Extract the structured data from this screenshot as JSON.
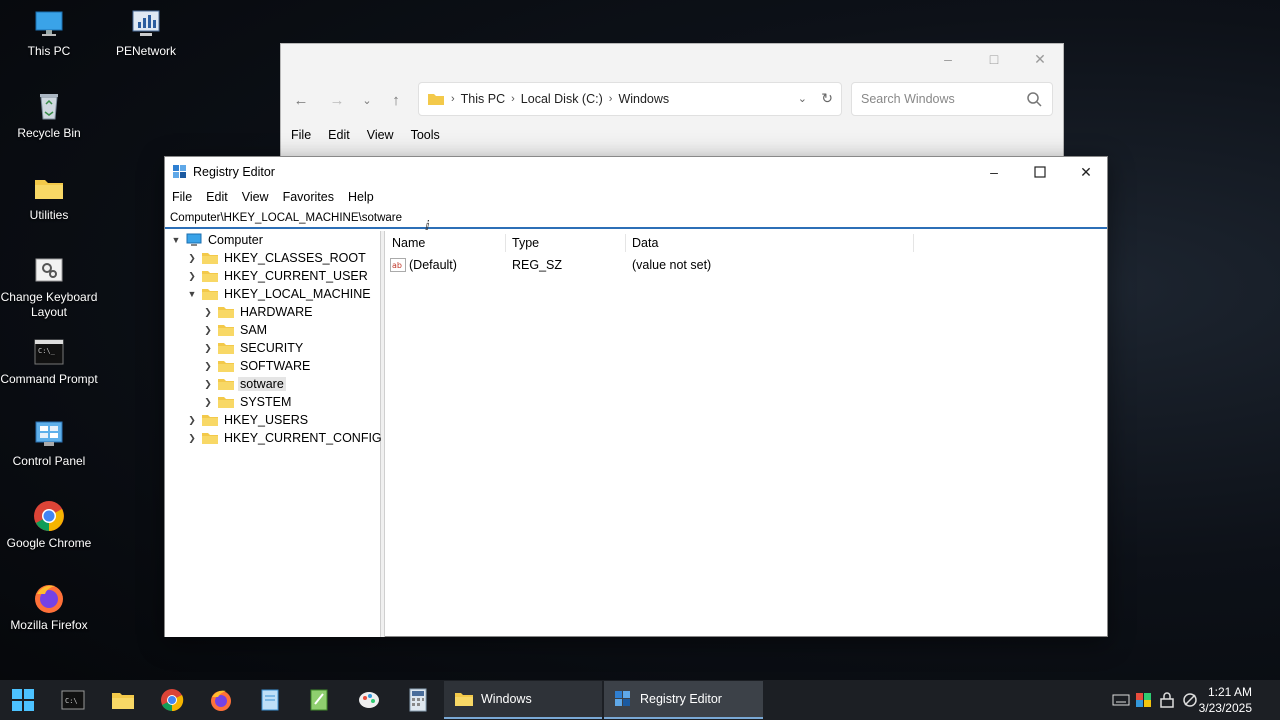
{
  "desktop": {
    "icons": [
      {
        "label": "This PC",
        "icon": "monitor-icon"
      },
      {
        "label": "PENetwork",
        "icon": "network-icon"
      },
      {
        "label": "Recycle Bin",
        "icon": "recycle-bin-icon"
      },
      {
        "label": "Utilities",
        "icon": "folder-icon"
      },
      {
        "label": "Change Keyboard Layout",
        "icon": "keyboard-icon"
      },
      {
        "label": "Command Prompt",
        "icon": "terminal-icon"
      },
      {
        "label": "Control Panel",
        "icon": "control-panel-icon"
      },
      {
        "label": "Google Chrome",
        "icon": "chrome-icon"
      },
      {
        "label": "Mozilla Firefox",
        "icon": "firefox-icon"
      }
    ]
  },
  "explorer": {
    "breadcrumb": [
      "This PC",
      "Local Disk (C:)",
      "Windows"
    ],
    "search_placeholder": "Search Windows",
    "menu": [
      "File",
      "Edit",
      "View",
      "Tools"
    ]
  },
  "regedit": {
    "title": "Registry Editor",
    "menu": [
      "File",
      "Edit",
      "View",
      "Favorites",
      "Help"
    ],
    "path": "Computer\\HKEY_LOCAL_MACHINE\\sotware",
    "tree": [
      {
        "label": "Computer",
        "level": 0,
        "expanded": true,
        "selected": false
      },
      {
        "label": "HKEY_CLASSES_ROOT",
        "level": 1,
        "expanded": false,
        "selected": false
      },
      {
        "label": "HKEY_CURRENT_USER",
        "level": 1,
        "expanded": false,
        "selected": false
      },
      {
        "label": "HKEY_LOCAL_MACHINE",
        "level": 1,
        "expanded": true,
        "selected": false
      },
      {
        "label": "HARDWARE",
        "level": 2,
        "expanded": false,
        "selected": false
      },
      {
        "label": "SAM",
        "level": 2,
        "expanded": false,
        "selected": false
      },
      {
        "label": "SECURITY",
        "level": 2,
        "expanded": false,
        "selected": false
      },
      {
        "label": "SOFTWARE",
        "level": 2,
        "expanded": false,
        "selected": false
      },
      {
        "label": "sotware",
        "level": 2,
        "expanded": false,
        "selected": true
      },
      {
        "label": "SYSTEM",
        "level": 2,
        "expanded": false,
        "selected": false
      },
      {
        "label": "HKEY_USERS",
        "level": 1,
        "expanded": false,
        "selected": false
      },
      {
        "label": "HKEY_CURRENT_CONFIG",
        "level": 1,
        "expanded": false,
        "selected": false
      }
    ],
    "columns": [
      "Name",
      "Type",
      "Data"
    ],
    "values": [
      {
        "name": "(Default)",
        "type": "REG_SZ",
        "data": "(value not set)"
      }
    ]
  },
  "taskbar": {
    "tasks": [
      {
        "label": "Windows",
        "icon": "folder-icon"
      },
      {
        "label": "Registry Editor",
        "icon": "registry-editor-icon"
      }
    ],
    "time": "1:21 AM",
    "date": "3/23/2025"
  },
  "colors": {
    "accent": "#2c6fb7",
    "folder": "#f3c94a",
    "taskbar": "#1c1f24"
  }
}
